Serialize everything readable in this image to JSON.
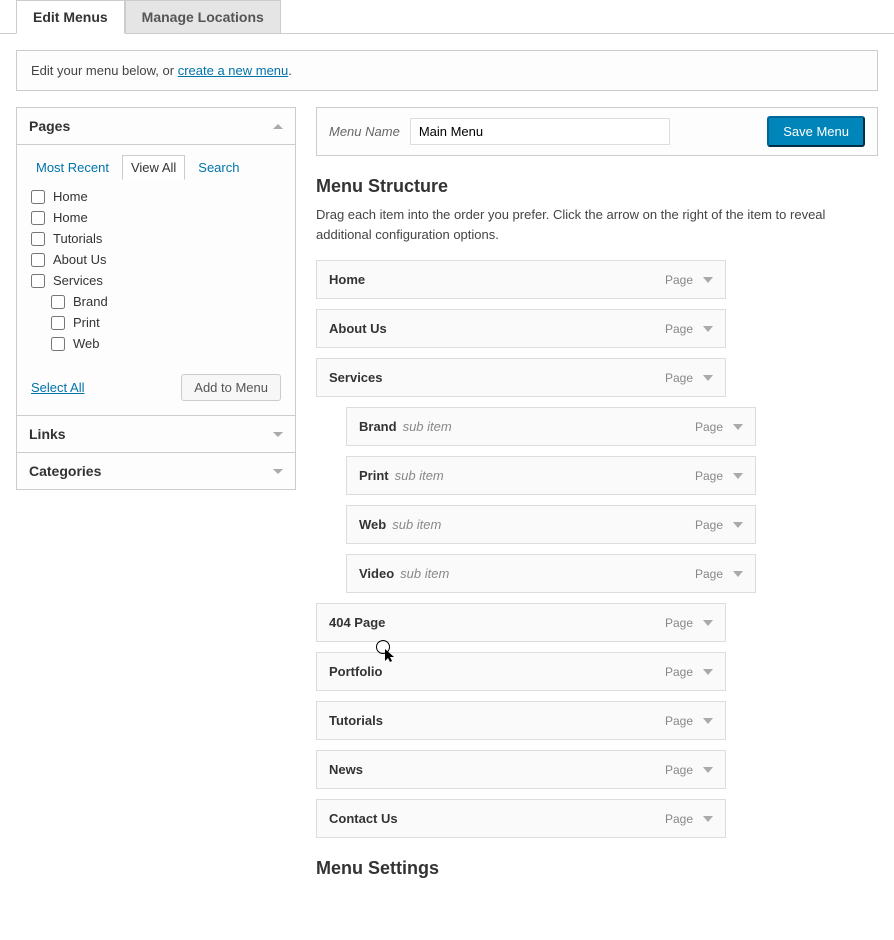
{
  "tabs": {
    "edit": "Edit Menus",
    "manage": "Manage Locations"
  },
  "notice_prefix": "Edit your menu below, or ",
  "notice_link": "create a new menu",
  "notice_suffix": ".",
  "sidebar": {
    "pages_title": "Pages",
    "links_title": "Links",
    "categories_title": "Categories",
    "subtabs": {
      "recent": "Most Recent",
      "viewall": "View All",
      "search": "Search"
    },
    "pages": [
      {
        "label": "Home",
        "indent": false
      },
      {
        "label": "Home",
        "indent": false
      },
      {
        "label": "Tutorials",
        "indent": false
      },
      {
        "label": "About Us",
        "indent": false
      },
      {
        "label": "Services",
        "indent": false
      },
      {
        "label": "Brand",
        "indent": true
      },
      {
        "label": "Print",
        "indent": true
      },
      {
        "label": "Web",
        "indent": true
      }
    ],
    "select_all": "Select All",
    "add_to_menu": "Add to Menu"
  },
  "menu_name_label": "Menu Name",
  "menu_name_value": "Main Menu",
  "save_menu": "Save Menu",
  "structure_title": "Menu Structure",
  "structure_desc": "Drag each item into the order you prefer. Click the arrow on the right of the item to reveal additional configuration options.",
  "sub_item_label": "sub item",
  "type_page": "Page",
  "menu_items": [
    {
      "label": "Home",
      "sub": false,
      "indent": false
    },
    {
      "label": "About Us",
      "sub": false,
      "indent": false
    },
    {
      "label": "Services",
      "sub": false,
      "indent": false
    },
    {
      "label": "Brand",
      "sub": true,
      "indent": true
    },
    {
      "label": "Print",
      "sub": true,
      "indent": true
    },
    {
      "label": "Web",
      "sub": true,
      "indent": true
    },
    {
      "label": "Video",
      "sub": true,
      "indent": true
    },
    {
      "label": "404 Page",
      "sub": false,
      "indent": false
    },
    {
      "label": "Portfolio",
      "sub": false,
      "indent": false
    },
    {
      "label": "Tutorials",
      "sub": false,
      "indent": false
    },
    {
      "label": "News",
      "sub": false,
      "indent": false
    },
    {
      "label": "Contact Us",
      "sub": false,
      "indent": false
    }
  ],
  "settings_title": "Menu Settings"
}
